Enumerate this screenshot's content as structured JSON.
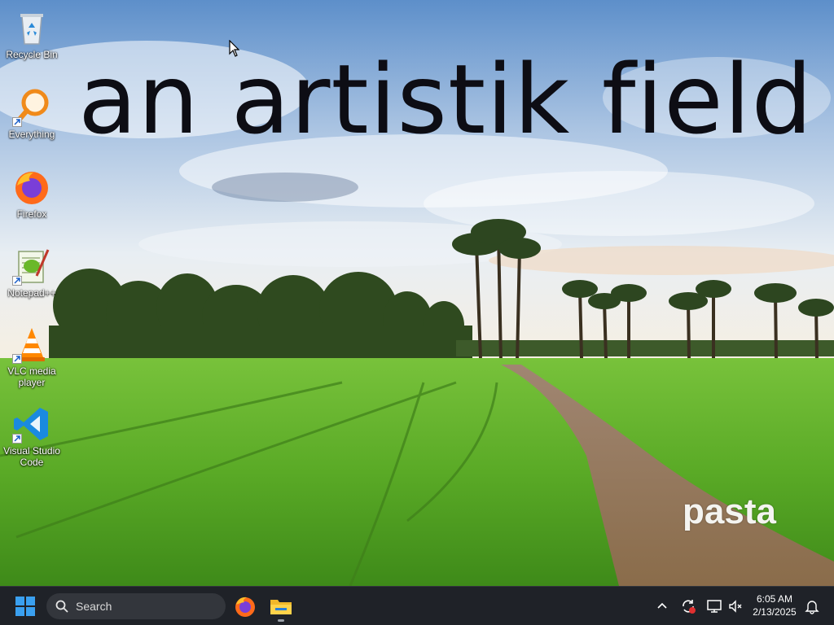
{
  "wallpaper": {
    "caption": "an artistik field",
    "signature": "pasta"
  },
  "desktop": {
    "icons": [
      {
        "label": "Recycle Bin",
        "icon": "recycle-bin-icon"
      },
      {
        "label": "Everything",
        "icon": "everything-search-icon"
      },
      {
        "label": "Firefox",
        "icon": "firefox-icon"
      },
      {
        "label": "Notepad++",
        "icon": "notepad-plus-plus-icon"
      },
      {
        "label": "VLC media player",
        "icon": "vlc-icon"
      },
      {
        "label": "Visual Studio Code",
        "icon": "vscode-icon"
      }
    ]
  },
  "taskbar": {
    "search_placeholder": "Search",
    "pinned_apps": [
      "firefox-icon",
      "file-explorer-icon"
    ],
    "tray_icons": [
      "chevron-up-icon",
      "sync-alert-icon",
      "network-icon",
      "volume-muted-icon",
      "notification-bell-icon"
    ],
    "clock": {
      "time": "6:05 AM",
      "date": "2/13/2025"
    }
  },
  "colors": {
    "taskbar_bg": "#1f2228",
    "start_blue": "#3aa0f0",
    "grass": "#5fae2a",
    "sky": "#7fa9d8"
  }
}
